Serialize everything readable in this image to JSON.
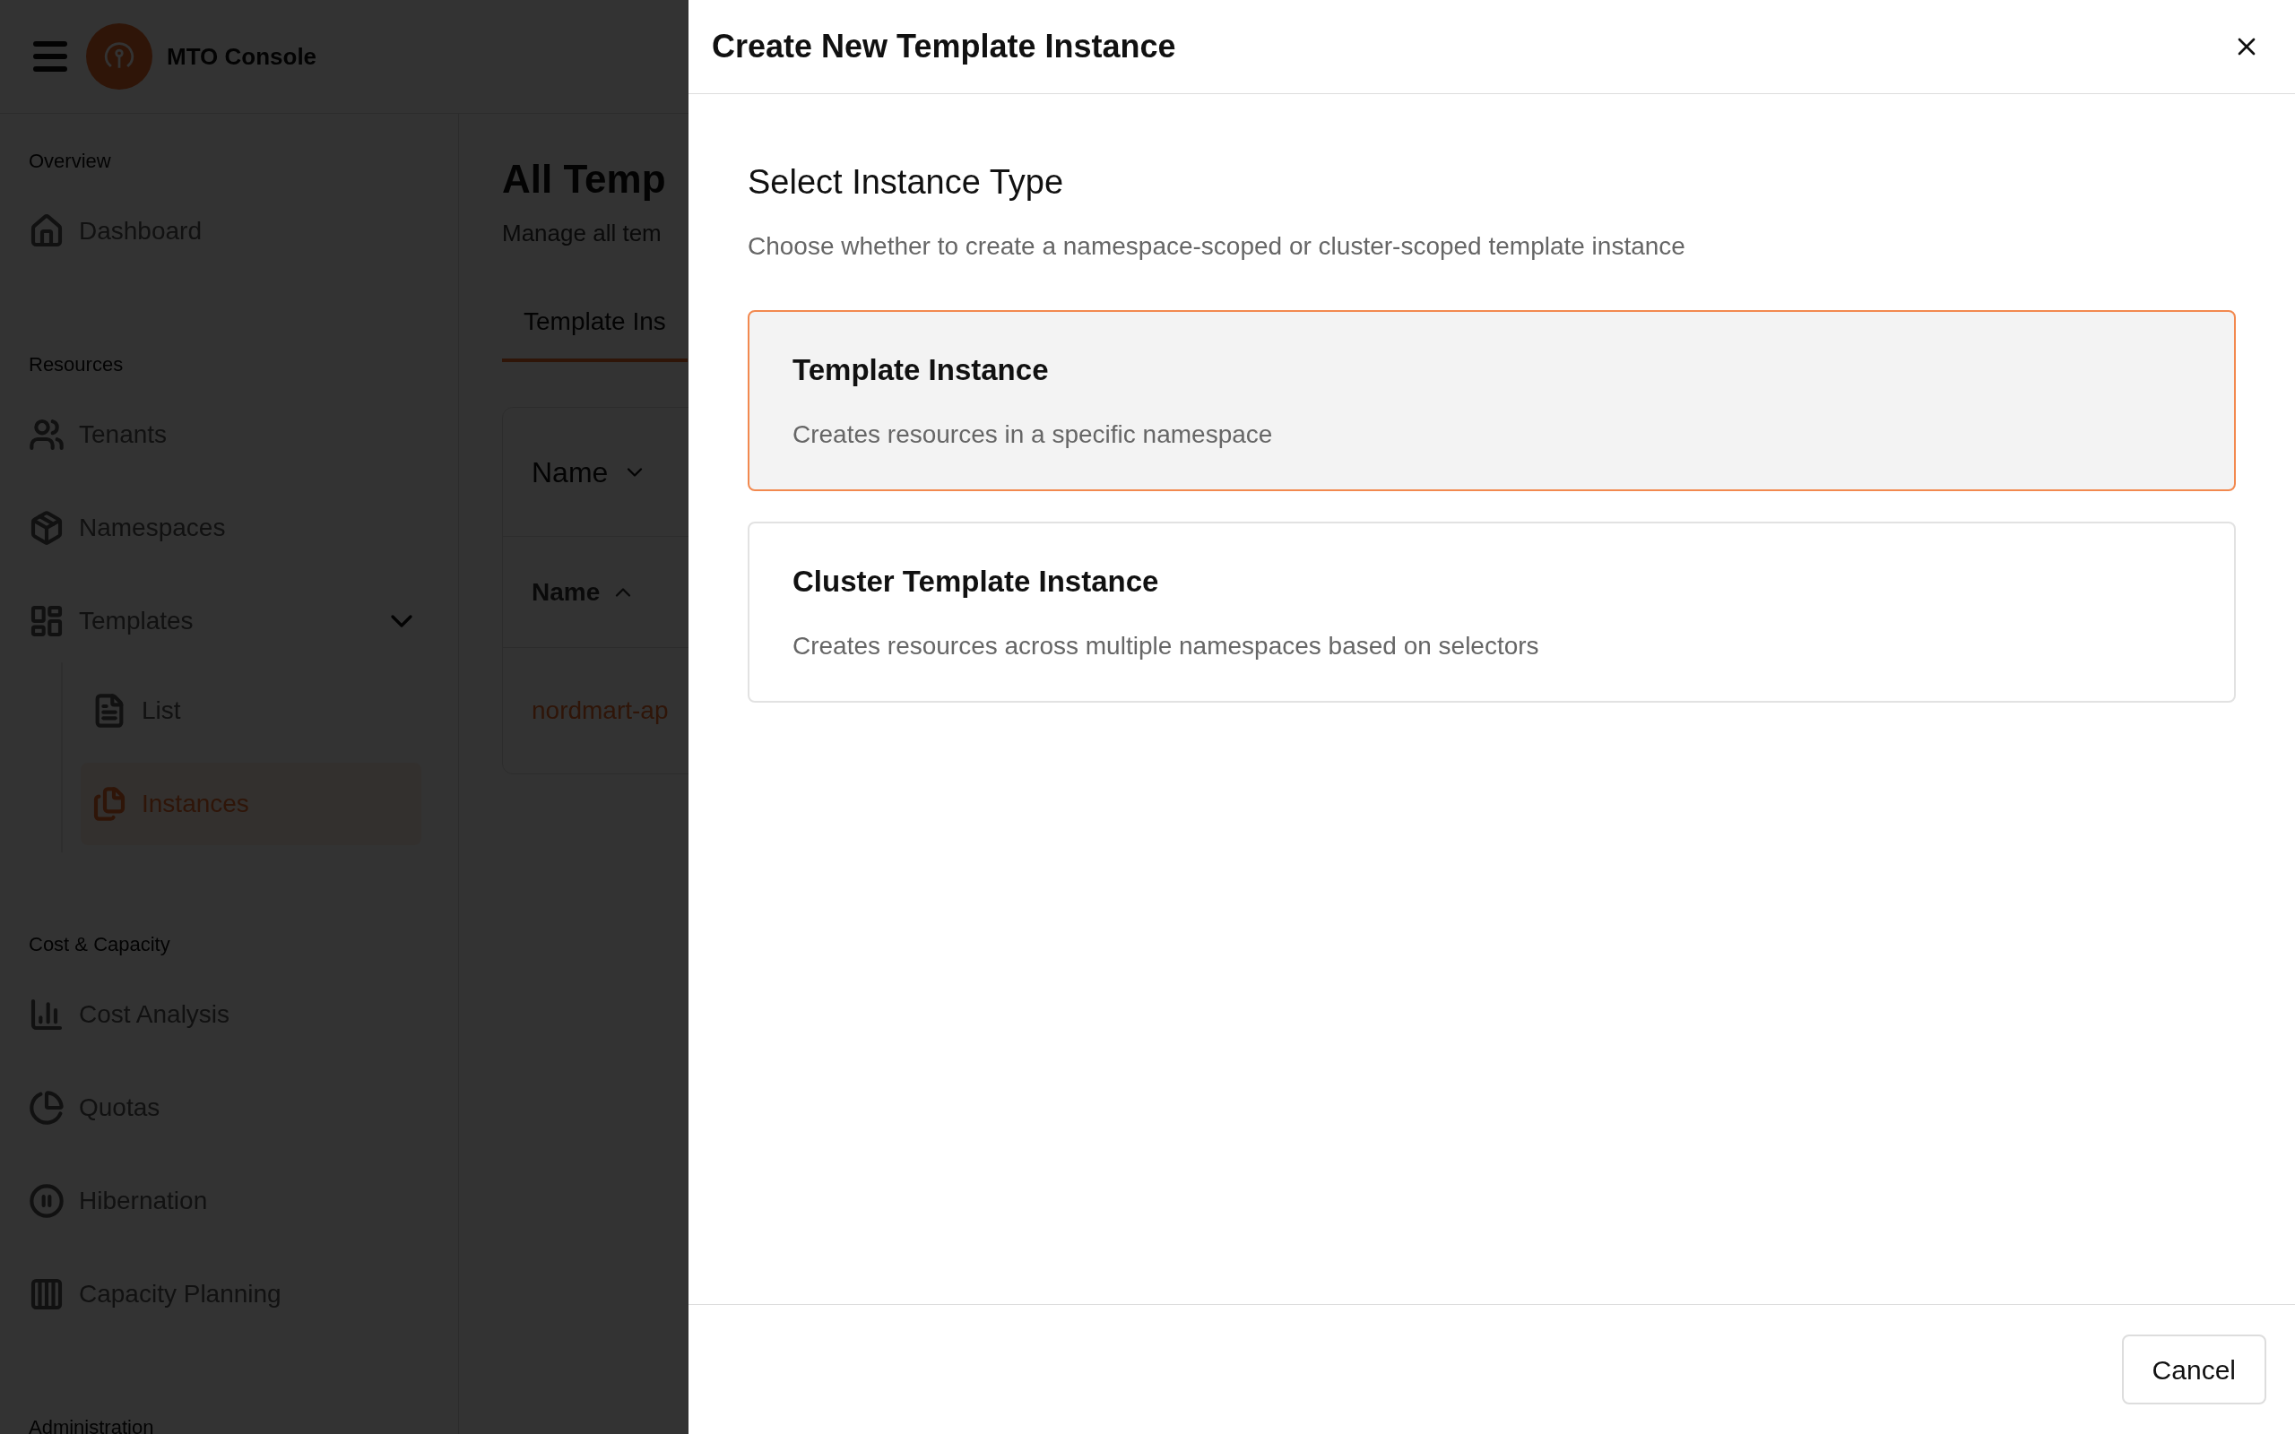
{
  "app": {
    "title": "MTO Console"
  },
  "sidebar": {
    "sections": [
      {
        "label": "Overview",
        "items": [
          {
            "label": "Dashboard",
            "selected": false
          }
        ]
      },
      {
        "label": "Resources",
        "items": [
          {
            "label": "Tenants",
            "selected": false
          },
          {
            "label": "Namespaces",
            "selected": false
          },
          {
            "label": "Templates",
            "selected": false,
            "expanded": true,
            "children": [
              {
                "label": "List",
                "selected": false
              },
              {
                "label": "Instances",
                "selected": true
              }
            ]
          }
        ]
      },
      {
        "label": "Cost & Capacity",
        "items": [
          {
            "label": "Cost Analysis",
            "selected": false
          },
          {
            "label": "Quotas",
            "selected": false
          },
          {
            "label": "Hibernation",
            "selected": false
          },
          {
            "label": "Capacity Planning",
            "selected": false
          }
        ]
      },
      {
        "label": "Administration"
      }
    ]
  },
  "main": {
    "title": "All Temp",
    "subtitle": "Manage all tem",
    "tabs": [
      {
        "label": "Template Ins",
        "selected": true
      }
    ],
    "filter": {
      "label": "Name"
    },
    "table": {
      "columns": [
        "Name"
      ],
      "rows": [
        [
          "nordmart-ap"
        ]
      ]
    }
  },
  "dialog": {
    "title": "Create New Template Instance",
    "heading": "Select Instance Type",
    "description": "Choose whether to create a namespace-scoped or cluster-scoped template instance",
    "options": [
      {
        "title": "Template Instance",
        "description": "Creates resources in a specific namespace",
        "selected": true
      },
      {
        "title": "Cluster Template Instance",
        "description": "Creates resources across multiple namespaces based on selectors",
        "selected": false
      }
    ],
    "buttons": [
      "Cancel"
    ]
  }
}
